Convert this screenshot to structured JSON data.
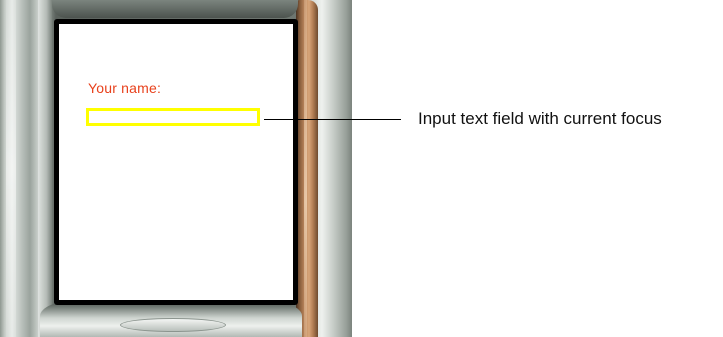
{
  "screen": {
    "field_label": "Your name:",
    "input_value": "",
    "input_placeholder": ""
  },
  "annotation": {
    "callout_text": "Input text field with current focus"
  },
  "colors": {
    "label_color": "#e8411c",
    "focus_border": "#ffff00",
    "screen_background": "#ffffff",
    "device_accent": "#c08a5f"
  }
}
